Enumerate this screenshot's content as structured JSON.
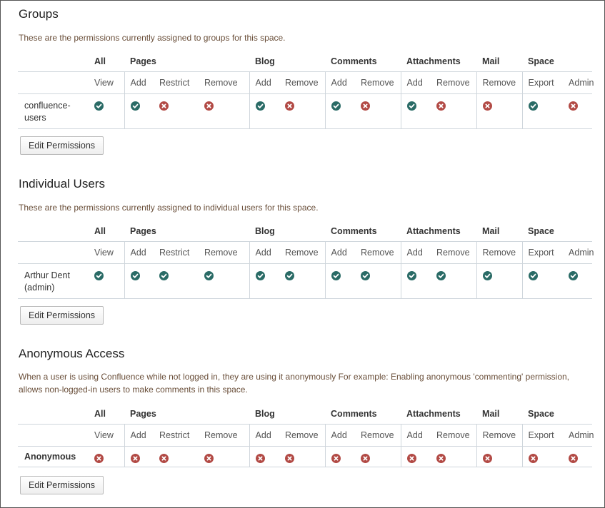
{
  "categories": [
    "All",
    "Pages",
    "Blog",
    "Comments",
    "Attachments",
    "Mail",
    "Space"
  ],
  "permissions": [
    "View",
    "Add",
    "Restrict",
    "Remove",
    "Add",
    "Remove",
    "Add",
    "Remove",
    "Add",
    "Remove",
    "Remove",
    "Export",
    "Admin"
  ],
  "status_colors": {
    "granted": "#2a6b66",
    "denied": "#b24a45"
  },
  "icon_names": {
    "granted": "check-circle-icon",
    "denied": "x-circle-icon"
  },
  "groups": {
    "title": "Groups",
    "description": "These are the permissions currently assigned to groups for this space.",
    "rows": [
      {
        "name": "confluence-users",
        "name_lines": [
          "confluence-",
          "users"
        ],
        "perms": [
          true,
          true,
          false,
          false,
          true,
          false,
          true,
          false,
          true,
          false,
          false,
          true,
          false
        ]
      }
    ],
    "edit_label": "Edit Permissions"
  },
  "users": {
    "title": "Individual Users",
    "description": "These are the permissions currently assigned to individual users for this space.",
    "rows": [
      {
        "name": "Arthur Dent (admin)",
        "name_lines": [
          "Arthur Dent",
          "(admin)"
        ],
        "perms": [
          true,
          true,
          true,
          true,
          true,
          true,
          true,
          true,
          true,
          true,
          true,
          true,
          true
        ]
      }
    ],
    "edit_label": "Edit Permissions"
  },
  "anonymous": {
    "title": "Anonymous Access",
    "description": "When a user is using Confluence while not logged in, they are using it anonymously For example: Enabling anonymous 'commenting' permission, allows non-logged-in users to make comments in this space.",
    "rows": [
      {
        "name": "Anonymous",
        "name_lines": [
          "Anonymous"
        ],
        "perms": [
          false,
          false,
          false,
          false,
          false,
          false,
          false,
          false,
          false,
          false,
          false,
          false,
          false
        ]
      }
    ],
    "edit_label": "Edit Permissions"
  }
}
